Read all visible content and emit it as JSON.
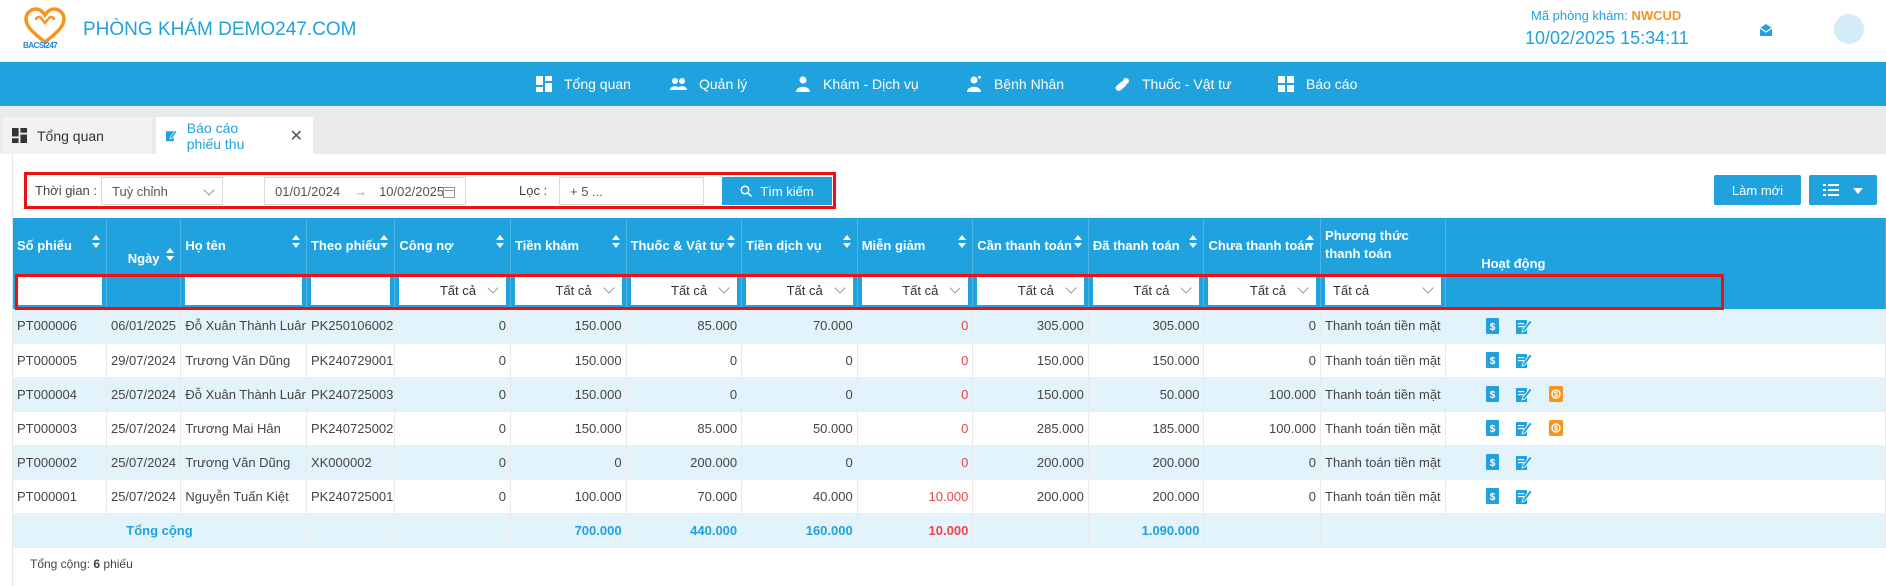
{
  "header": {
    "clinic_name": "PHÒNG KHÁM DEMO247.COM",
    "logo_text": "BACSI247",
    "clinic_code_label": "Mã phòng khám:",
    "clinic_code": "NWCUD",
    "datetime": "10/02/2025 15:34:11",
    "colors": {
      "primary": "#1fa2dd",
      "accent": "#f7941d",
      "highlight": "#ee1111"
    }
  },
  "nav": {
    "items": [
      {
        "label": "Tổng quan",
        "icon": "dashboard-icon"
      },
      {
        "label": "Quản lý",
        "icon": "users-icon"
      },
      {
        "label": "Khám - Dịch vụ",
        "icon": "doctor-icon"
      },
      {
        "label": "Bệnh Nhân",
        "icon": "patient-icon"
      },
      {
        "label": "Thuốc - Vật tư",
        "icon": "pills-icon"
      },
      {
        "label": "Báo cáo",
        "icon": "report-icon"
      }
    ]
  },
  "tabs": [
    {
      "label": "Tổng quan",
      "active": false
    },
    {
      "label": "Báo cáo phiếu thu",
      "active": true
    }
  ],
  "filters": {
    "time_label": "Thời gian :",
    "time_value": "Tuỳ chỉnh",
    "date_from": "01/01/2024",
    "date_to": "10/02/2025",
    "filter_label": "Lọc :",
    "filter_value": "+ 5 ...",
    "search_button": "Tìm kiếm",
    "refresh_button": "Làm mới"
  },
  "table": {
    "columns": [
      "Số phiếu",
      "Ngày",
      "Họ tên",
      "Theo phiếu",
      "Công nợ",
      "Tiền khám",
      "Thuốc & Vật tư",
      "Tiền dịch vụ",
      "Miễn giảm",
      "Cần thanh toán",
      "Đã thanh toán",
      "Chưa thanh toán",
      "Phương thức thanh toán",
      "Hoạt động"
    ],
    "filter_all": "Tất cả",
    "rows": [
      [
        "PT000006",
        "06/01/2025",
        "Đỗ Xuân Thành Luân",
        "PK250106002",
        "0",
        "150.000",
        "85.000",
        "70.000",
        "0",
        "305.000",
        "305.000",
        "0",
        "Thanh toán tiền mặt"
      ],
      [
        "PT000005",
        "29/07/2024",
        "Trương Văn Dũng",
        "PK240729001",
        "0",
        "150.000",
        "0",
        "0",
        "0",
        "150.000",
        "150.000",
        "0",
        "Thanh toán tiền mặt"
      ],
      [
        "PT000004",
        "25/07/2024",
        "Đỗ Xuân Thành Luân",
        "PK240725003",
        "0",
        "150.000",
        "0",
        "0",
        "0",
        "150.000",
        "50.000",
        "100.000",
        "Thanh toán tiền mặt"
      ],
      [
        "PT000003",
        "25/07/2024",
        "Trương Mai Hân",
        "PK240725002",
        "0",
        "150.000",
        "85.000",
        "50.000",
        "0",
        "285.000",
        "185.000",
        "100.000",
        "Thanh toán tiền mặt"
      ],
      [
        "PT000002",
        "25/07/2024",
        "Trương Văn Dũng",
        "XK000002",
        "0",
        "0",
        "200.000",
        "0",
        "0",
        "200.000",
        "200.000",
        "0",
        "Thanh toán tiền mặt"
      ],
      [
        "PT000001",
        "25/07/2024",
        "Nguyễn Tuấn Kiệt",
        "PK240725001",
        "0",
        "100.000",
        "70.000",
        "40.000",
        "10.000",
        "200.000",
        "200.000",
        "0",
        "Thanh toán tiền mặt"
      ]
    ],
    "row_actions": [
      [
        "invoice-icon",
        "edit-icon"
      ],
      [
        "invoice-icon",
        "edit-icon"
      ],
      [
        "invoice-icon",
        "edit-icon",
        "pay-debt-icon"
      ],
      [
        "invoice-icon",
        "edit-icon",
        "pay-debt-icon"
      ],
      [
        "invoice-icon",
        "edit-icon"
      ],
      [
        "invoice-icon",
        "edit-icon"
      ]
    ],
    "totals": {
      "label": "Tổng cộng",
      "tien_kham": "700.000",
      "thuoc_vat_tu": "440.000",
      "tien_dich_vu": "160.000",
      "mien_giam": "10.000",
      "da_thanh_toan": "1.090.000"
    }
  },
  "footer": {
    "label": "Tổng cộng:",
    "count": "6",
    "unit": "phiếu"
  }
}
